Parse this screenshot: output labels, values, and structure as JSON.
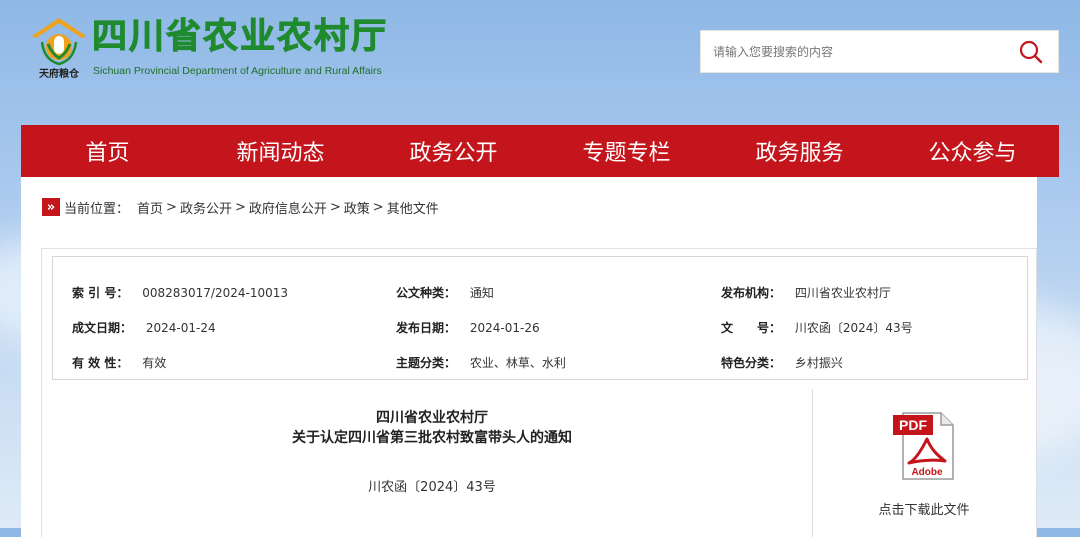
{
  "header": {
    "logo_caption": "天府粮仓",
    "title_cn": "四川省农业农村厅",
    "title_en": "Sichuan Provincial Department of Agriculture and Rural Affairs",
    "search": {
      "placeholder": "请输入您要搜索的内容",
      "icon": "search-icon"
    }
  },
  "nav": {
    "items": [
      {
        "label": "首页"
      },
      {
        "label": "新闻动态"
      },
      {
        "label": "政务公开"
      },
      {
        "label": "专题专栏"
      },
      {
        "label": "政务服务"
      },
      {
        "label": "公众参与"
      }
    ],
    "background": "#c4151c"
  },
  "breadcrumb": {
    "prefix": "当前位置：",
    "items": [
      "首页",
      "政务公开",
      "政府信息公开",
      "政策",
      "其他文件"
    ],
    "separator": ">"
  },
  "meta": {
    "index_label": "索 引 号：",
    "index_value": "008283017/2024-10013",
    "type_label": "公文种类：",
    "type_value": "通知",
    "issuer_label": "发布机构：",
    "issuer_value": "四川省农业农村厅",
    "written_label": "成文日期：",
    "written_value": "2024-01-24",
    "published_label": "发布日期：",
    "published_value": "2024-01-26",
    "docno_label": "文　　号：",
    "docno_value": "川农函〔2024〕43号",
    "validity_label": "有 效 性：",
    "validity_value": "有效",
    "topic_label": "主题分类：",
    "topic_value": "农业、林草、水利",
    "feature_label": "特色分类：",
    "feature_value": "乡村振兴"
  },
  "document": {
    "org": "四川省农业农村厅",
    "title": "关于认定四川省第三批农村致富带头人的通知",
    "number": "川农函〔2024〕43号"
  },
  "download": {
    "icon": "pdf-file-icon",
    "pdf_label": "PDF",
    "adobe_label": "Adobe",
    "text": "点击下载此文件"
  },
  "colors": {
    "brand_red": "#c4151c",
    "brand_green": "#1f8a2e",
    "logo_orange": "#f0a21a"
  }
}
